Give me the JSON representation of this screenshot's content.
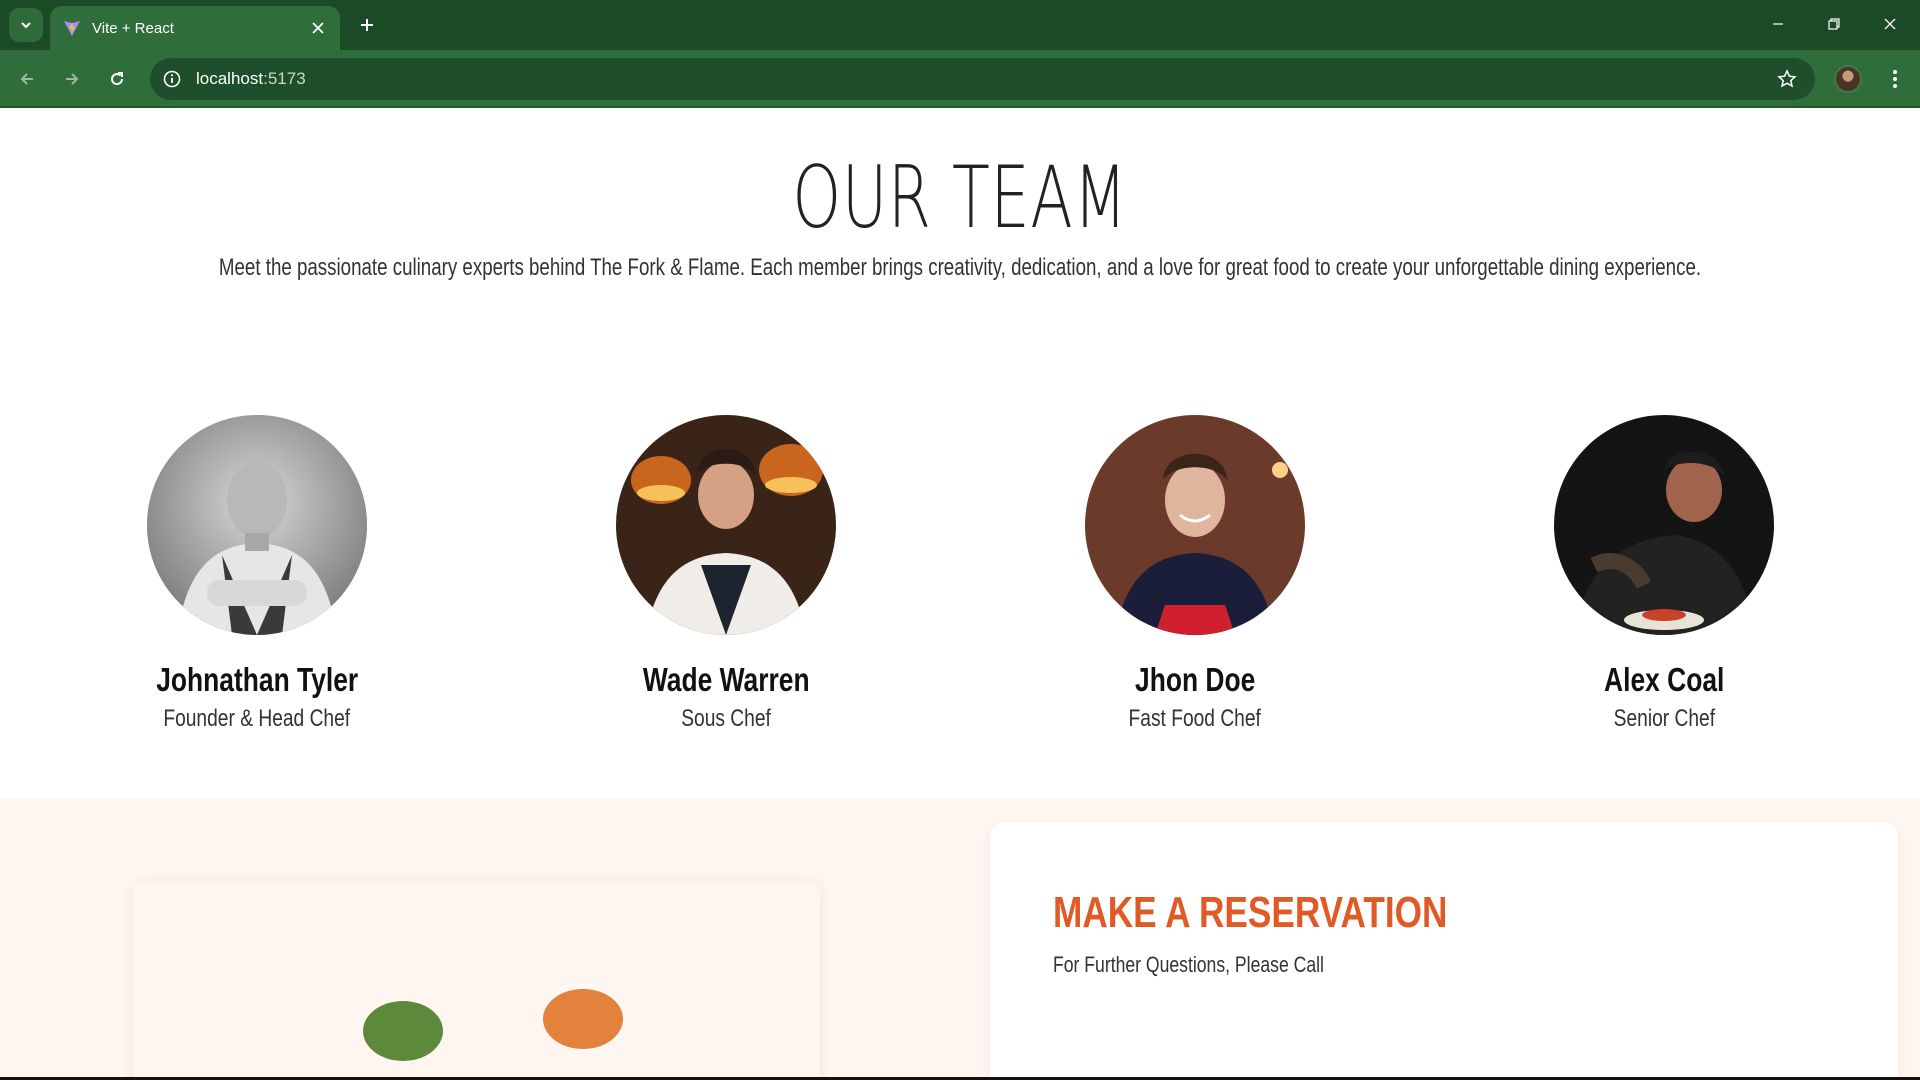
{
  "browser": {
    "tab_title": "Vite + React",
    "url_host": "localhost",
    "url_port": ":5173"
  },
  "team": {
    "title": "OUR TEAM",
    "subtitle": "Meet the passionate culinary experts behind The Fork & Flame. Each member brings creativity, dedication, and a love for great food to create your unforgettable dining experience.",
    "members": [
      {
        "name": "Johnathan Tyler",
        "role": "Founder & Head Chef"
      },
      {
        "name": "Wade Warren",
        "role": "Sous Chef"
      },
      {
        "name": "Jhon Doe",
        "role": "Fast Food Chef"
      },
      {
        "name": "Alex Coal",
        "role": "Senior Chef"
      }
    ]
  },
  "reservation": {
    "title": "MAKE A RESERVATION",
    "subtitle": "For Further Questions, Please Call"
  },
  "colors": {
    "tabstrip": "#1b4a26",
    "toolbar": "#2f6d3b",
    "accent": "#e05a25",
    "section_bg": "#fff6f1"
  }
}
